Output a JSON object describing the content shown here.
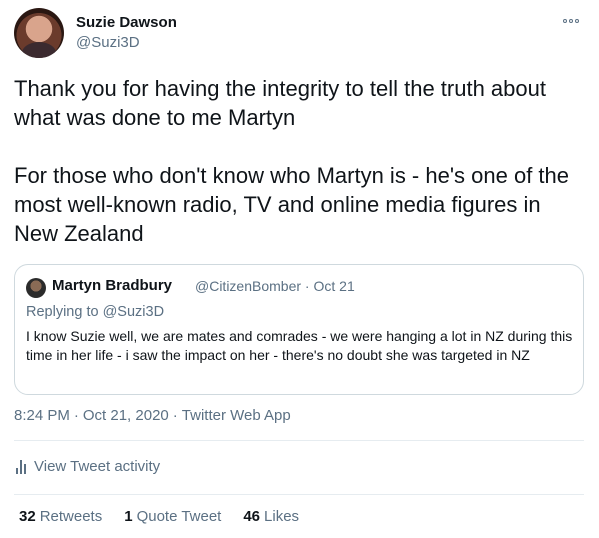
{
  "author": {
    "display_name": "Suzie Dawson",
    "handle": "@Suzi3D"
  },
  "tweet": {
    "paragraphs": [
      "Thank you for having the integrity to tell the truth about what was done to me Martyn",
      "For those who don't know who Martyn is - he's one of the most well-known radio, TV and online media figures in New Zealand"
    ]
  },
  "quoted_tweet": {
    "display_name": "Martyn Bradbury",
    "handle": "@CitizenBomber",
    "date": "Oct 21",
    "meta_separator": "·",
    "replying_prefix": "Replying to",
    "replying_handle": "@Suzi3D",
    "body": "I know Suzie well, we are mates and comrades - we were hanging a lot in NZ during this time in her life - i saw the impact on her - there's no doubt she was targeted in NZ"
  },
  "meta": {
    "time": "8:24 PM",
    "date": "Oct 21, 2020",
    "source": "Twitter Web App",
    "separator": "·"
  },
  "activity": {
    "label": "View Tweet activity"
  },
  "stats": [
    {
      "count": "32",
      "label": "Retweets"
    },
    {
      "count": "1",
      "label": "Quote Tweet"
    },
    {
      "count": "46",
      "label": "Likes"
    }
  ],
  "colors": {
    "text_primary": "#0f1419",
    "text_secondary": "#5b7083",
    "border": "#cfd9de",
    "divider": "#e6ecf0"
  },
  "icons": {
    "more": "more-dots-icon",
    "activity": "bar-chart-icon"
  }
}
